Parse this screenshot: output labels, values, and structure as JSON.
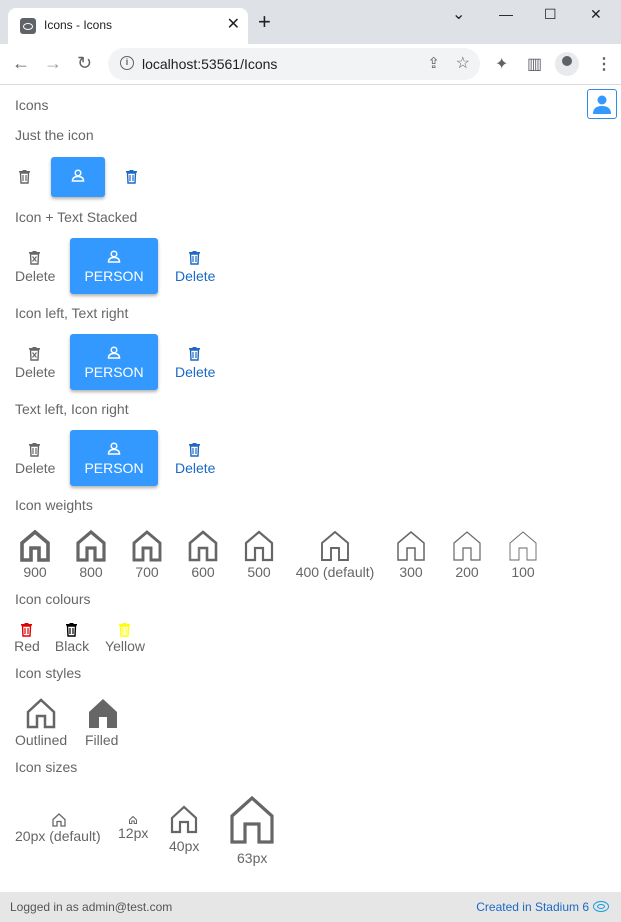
{
  "browser": {
    "tab_title": "Icons - Icons",
    "url": "localhost:53561/Icons",
    "tab_close": "✕",
    "new_tab": "+",
    "minimize": "—",
    "maximize": "☐",
    "window_close": "✕",
    "tab_search": "⌄"
  },
  "page": {
    "title": "Icons",
    "sections": {
      "just_icon": "Just the icon",
      "stacked": "Icon + Text Stacked",
      "left_right": "Icon left, Text right",
      "text_left": "Text left, Icon right",
      "weights": "Icon weights",
      "colours": "Icon colours",
      "styles": "Icon styles",
      "sizes": "Icon sizes"
    },
    "buttons": {
      "delete": "Delete",
      "person": "PERSON"
    },
    "weights": [
      "900",
      "800",
      "700",
      "600",
      "500",
      "400 (default)",
      "300",
      "200",
      "100"
    ],
    "colours": [
      {
        "label": "Red",
        "color": "#e00000"
      },
      {
        "label": "Black",
        "color": "#000000"
      },
      {
        "label": "Yellow",
        "color": "#ffff00"
      }
    ],
    "styles": [
      "Outlined",
      "Filled"
    ],
    "sizes": [
      "20px (default)",
      "12px",
      "40px",
      "63px"
    ]
  },
  "footer": {
    "logged_in": "Logged in as admin@test.com",
    "created_in": "Created in Stadium 6"
  },
  "colors": {
    "accent": "#3399ff",
    "link": "#1c69c4",
    "icon_grey": "#666666"
  }
}
